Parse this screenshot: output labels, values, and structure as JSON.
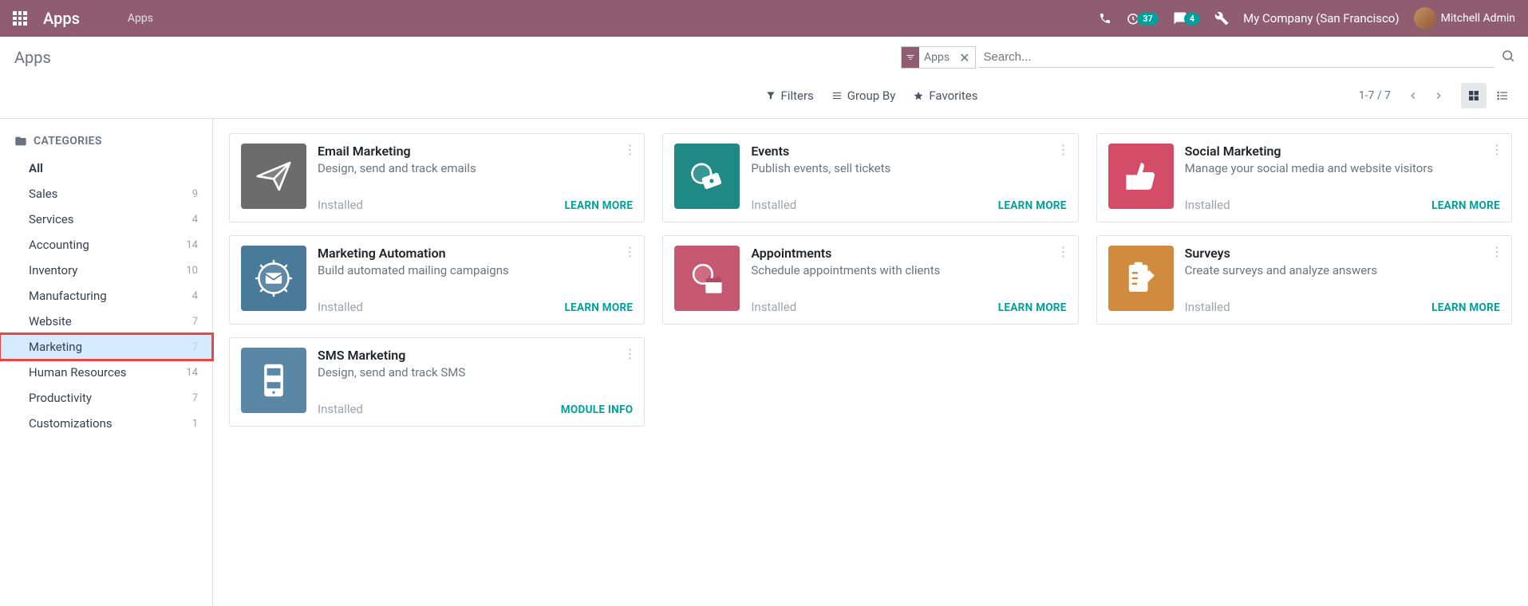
{
  "header": {
    "brand": "Apps",
    "breadcrumb": "Apps",
    "timer_badge": "37",
    "chat_badge": "4",
    "company": "My Company (San Francisco)",
    "user": "Mitchell Admin"
  },
  "control": {
    "title": "Apps",
    "search_facet": "Apps",
    "search_placeholder": "Search...",
    "filters": "Filters",
    "group_by": "Group By",
    "favorites": "Favorites",
    "pager": "1-7 / 7"
  },
  "sidebar": {
    "heading": "CATEGORIES",
    "items": [
      {
        "label": "All",
        "count": "",
        "bold": true
      },
      {
        "label": "Sales",
        "count": "9"
      },
      {
        "label": "Services",
        "count": "4"
      },
      {
        "label": "Accounting",
        "count": "14"
      },
      {
        "label": "Inventory",
        "count": "10"
      },
      {
        "label": "Manufacturing",
        "count": "4"
      },
      {
        "label": "Website",
        "count": "7"
      },
      {
        "label": "Marketing",
        "count": "7",
        "active": true
      },
      {
        "label": "Human Resources",
        "count": "14"
      },
      {
        "label": "Productivity",
        "count": "7"
      },
      {
        "label": "Customizations",
        "count": "1"
      }
    ]
  },
  "cards": [
    {
      "title": "Email Marketing",
      "desc": "Design, send and track emails",
      "status": "Installed",
      "action": "LEARN MORE",
      "color": "#6c6c6c",
      "icon": "paper-plane"
    },
    {
      "title": "Events",
      "desc": "Publish events, sell tickets",
      "status": "Installed",
      "action": "LEARN MORE",
      "color": "#1f8a85",
      "icon": "ticket-globe"
    },
    {
      "title": "Social Marketing",
      "desc": "Manage your social media and website visitors",
      "status": "Installed",
      "action": "LEARN MORE",
      "color": "#d34d69",
      "icon": "thumbs-up"
    },
    {
      "title": "Marketing Automation",
      "desc": "Build automated mailing campaigns",
      "status": "Installed",
      "action": "LEARN MORE",
      "color": "#4a7a99",
      "icon": "gear-mail"
    },
    {
      "title": "Appointments",
      "desc": "Schedule appointments with clients",
      "status": "Installed",
      "action": "LEARN MORE",
      "color": "#c75872",
      "icon": "calendar-globe"
    },
    {
      "title": "Surveys",
      "desc": "Create surveys and analyze answers",
      "status": "Installed",
      "action": "LEARN MORE",
      "color": "#d08b3f",
      "icon": "clipboard-pencil"
    },
    {
      "title": "SMS Marketing",
      "desc": "Design, send and track SMS",
      "status": "Installed",
      "action": "MODULE INFO",
      "color": "#5b87a6",
      "icon": "phone-sms"
    }
  ]
}
